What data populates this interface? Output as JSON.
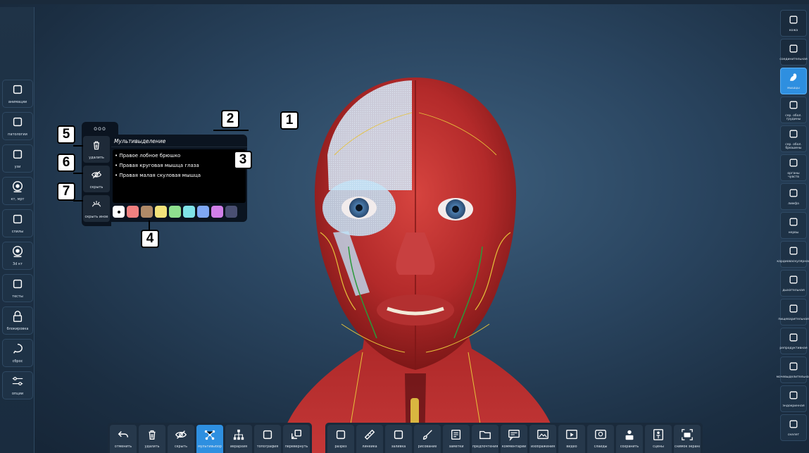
{
  "left_sidebar": [
    {
      "label": "анимации",
      "icon": "running-figure-icon"
    },
    {
      "label": "патологии",
      "icon": "lungs-icon"
    },
    {
      "label": "узи",
      "icon": "ultrasound-icon"
    },
    {
      "label": "кт, мрт",
      "icon": "ct-scan-icon"
    },
    {
      "label": "спилы",
      "icon": "body-slice-icon"
    },
    {
      "label": "3d кт",
      "icon": "ct-3d-icon"
    },
    {
      "label": "тесты",
      "icon": "test-clipboard-icon"
    },
    {
      "label": "блокировка",
      "icon": "lock-icon"
    },
    {
      "label": "сброс",
      "icon": "reset-icon"
    },
    {
      "label": "опции",
      "icon": "options-sliders-icon"
    }
  ],
  "right_sidebar": [
    {
      "label": "кожа",
      "icon": "skin-icon",
      "state": "dim"
    },
    {
      "label": "соединительная",
      "icon": "connective-tissue-icon",
      "state": "dim"
    },
    {
      "label": "мышцы",
      "icon": "muscle-icon",
      "state": "active"
    },
    {
      "label": "сер. обол. грудины",
      "icon": "chest-serous-icon",
      "state": "on"
    },
    {
      "label": "сер. обол. брюшины",
      "icon": "abdomen-serous-icon",
      "state": "on"
    },
    {
      "label": "органы чувств",
      "icon": "sense-organs-icon",
      "state": "on"
    },
    {
      "label": "лимфа",
      "icon": "lymph-icon",
      "state": "on"
    },
    {
      "label": "нервы",
      "icon": "nerves-icon",
      "state": "on"
    },
    {
      "label": "кардиоваскулярная",
      "icon": "heart-icon",
      "state": "on"
    },
    {
      "label": "дыхательная",
      "icon": "respiratory-icon",
      "state": "on"
    },
    {
      "label": "пищеварительная",
      "icon": "digestive-icon",
      "state": "on"
    },
    {
      "label": "репродуктивная",
      "icon": "reproductive-icon",
      "state": "on"
    },
    {
      "label": "мочевыделительная",
      "icon": "kidney-icon",
      "state": "on"
    },
    {
      "label": "эндокринная",
      "icon": "endocrine-icon",
      "state": "on"
    },
    {
      "label": "скелет",
      "icon": "skeleton-icon",
      "state": "on"
    }
  ],
  "panel": {
    "handle": "ooo",
    "title": "Мультивыделение",
    "items": [
      "• Правое лобное брюшко",
      "• Правая круговая мышца глаза",
      "• Правая малая скуловая мышца"
    ],
    "tools": [
      {
        "label": "удалить",
        "icon": "trash-icon"
      },
      {
        "label": "скрыть",
        "icon": "eye-slash-icon"
      },
      {
        "label": "скрыть иное",
        "icon": "hide-others-icon"
      }
    ],
    "swatches": [
      "#ffffff",
      "#f08080",
      "#b08a68",
      "#f2e27a",
      "#8fe08f",
      "#7fe3e8",
      "#7fa8f5",
      "#d07fe8",
      "#4a4f72"
    ]
  },
  "callouts": [
    "1",
    "2",
    "3",
    "4",
    "5",
    "6",
    "7"
  ],
  "bottom_left": [
    {
      "label": "отменить",
      "icon": "undo-icon"
    },
    {
      "label": "удалить",
      "icon": "trash-icon"
    },
    {
      "label": "скрыть",
      "icon": "eye-slash-icon"
    },
    {
      "label": "мультивыбор",
      "icon": "multiselect-icon",
      "active": true
    },
    {
      "label": "иерархия",
      "icon": "hierarchy-icon"
    },
    {
      "label": "топография",
      "icon": "topography-icon"
    },
    {
      "label": "перевернуть",
      "icon": "flip-icon"
    }
  ],
  "bottom_right": [
    {
      "label": "разрез",
      "icon": "cut-icon"
    },
    {
      "label": "линейка",
      "icon": "ruler-icon"
    },
    {
      "label": "заливка",
      "icon": "fill-icon"
    },
    {
      "label": "рисование",
      "icon": "brush-icon"
    },
    {
      "label": "заметки",
      "icon": "notes-icon"
    },
    {
      "label": "предпочтения",
      "icon": "folder-icon"
    },
    {
      "label": "комментарии",
      "icon": "comments-icon"
    },
    {
      "label": "изображения",
      "icon": "images-icon"
    },
    {
      "label": "видео",
      "icon": "video-icon"
    },
    {
      "label": "слайды",
      "icon": "slides-icon"
    },
    {
      "label": "сохранить",
      "icon": "save-user-icon"
    },
    {
      "label": "сцены",
      "icon": "scenes-icon"
    },
    {
      "label": "снимок экрана",
      "icon": "screenshot-icon"
    }
  ]
}
